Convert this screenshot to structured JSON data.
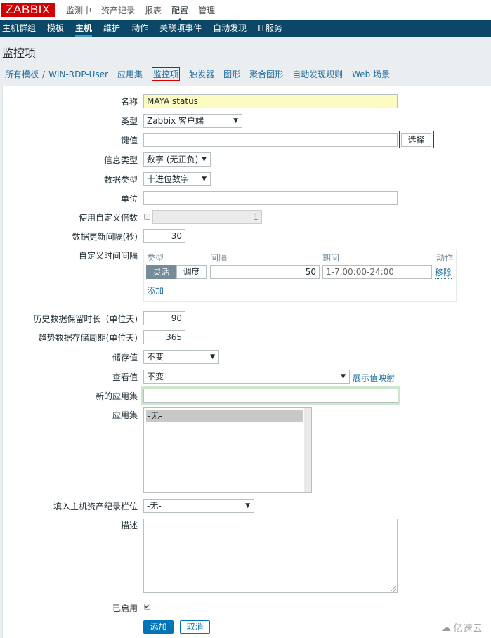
{
  "topbar": {
    "logo": "ZABBIX",
    "menu": [
      {
        "label": "监测中",
        "active": false
      },
      {
        "label": "资产记录",
        "active": false
      },
      {
        "label": "报表",
        "active": false
      },
      {
        "label": "配置",
        "active": true
      },
      {
        "label": "管理",
        "active": false
      }
    ]
  },
  "subnav": {
    "items": [
      {
        "label": "主机群组",
        "active": false
      },
      {
        "label": "模板",
        "active": false
      },
      {
        "label": "主机",
        "active": true
      },
      {
        "label": "维护",
        "active": false
      },
      {
        "label": "动作",
        "active": false
      },
      {
        "label": "关联项事件",
        "active": false
      },
      {
        "label": "自动发现",
        "active": false
      },
      {
        "label": "IT服务",
        "active": false
      }
    ]
  },
  "page_title": "监控项",
  "tabs": {
    "breadcrumb_root": "所有模板",
    "breadcrumb_sep": "/",
    "breadcrumb_host": "WIN-RDP-User",
    "items": [
      {
        "label": "应用集",
        "selected": false
      },
      {
        "label": "监控项",
        "selected": true
      },
      {
        "label": "触发器",
        "selected": false
      },
      {
        "label": "图形",
        "selected": false
      },
      {
        "label": "聚合图形",
        "selected": false
      },
      {
        "label": "自动发现规则",
        "selected": false
      },
      {
        "label": "Web 场景",
        "selected": false
      }
    ]
  },
  "form": {
    "name": {
      "label": "名称",
      "value": "MAYA status"
    },
    "type": {
      "label": "类型",
      "value": "Zabbix 客户端"
    },
    "key": {
      "label": "键值",
      "value": "",
      "select_button": "选择"
    },
    "info_type": {
      "label": "信息类型",
      "value": "数字 (无正负)"
    },
    "data_type": {
      "label": "数据类型",
      "value": "十进位数字"
    },
    "units": {
      "label": "单位",
      "value": ""
    },
    "multiplier": {
      "label": "使用自定义倍数",
      "checked": false,
      "value": "1"
    },
    "update_interval": {
      "label": "数据更新间隔(秒)",
      "value": "30"
    },
    "custom_intervals": {
      "label": "自定义时间间隔",
      "headers": {
        "type": "类型",
        "interval": "间隔",
        "period": "期间",
        "action": "动作"
      },
      "rows": [
        {
          "type_flexible": "灵活",
          "type_scheduling": "调度",
          "selected_type": "灵活",
          "interval": "50",
          "period": "1-7,00:00-24:00",
          "action": "移除"
        }
      ],
      "add_link": "添加"
    },
    "history": {
      "label": "历史数据保留时长（单位天)",
      "value": "90"
    },
    "trends": {
      "label": "趋势数据存储周期(单位天)",
      "value": "365"
    },
    "store_value": {
      "label": "储存值",
      "value": "不变"
    },
    "show_value": {
      "label": "查看值",
      "value": "不变",
      "mapping_link": "展示值映射"
    },
    "new_application": {
      "label": "新的应用集",
      "value": ""
    },
    "applications": {
      "label": "应用集",
      "options": [
        "-无-"
      ],
      "selected": "-无-"
    },
    "inventory_field": {
      "label": "填入主机资产纪录栏位",
      "value": "-无-"
    },
    "description": {
      "label": "描述",
      "value": ""
    },
    "enabled": {
      "label": "已启用",
      "checked": true
    },
    "add_button": "添加",
    "cancel_button": "取消"
  },
  "watermark": "亿速云"
}
